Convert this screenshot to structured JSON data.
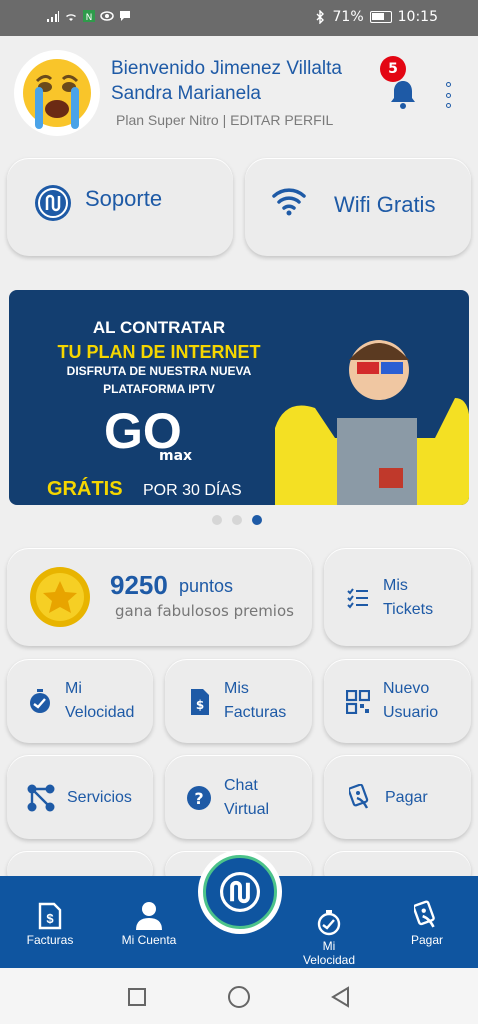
{
  "status": {
    "battery": "71%",
    "time": "10:15"
  },
  "header": {
    "welcome": "Bienvenido Jimenez Villalta Sandra Marianela",
    "plan": "Plan Super Nitro | EDITAR PERFIL",
    "notifications": "5"
  },
  "quick": {
    "support": "Soporte",
    "wifi": "Wifi Gratis"
  },
  "banner": {
    "line1": "AL CONTRATAR",
    "line2": "TU PLAN DE INTERNET",
    "line3": "DISFRUTA DE NUESTRA NUEVA",
    "line4": "PLATAFORMA IPTV",
    "brand": "GO",
    "brand_sub": "max",
    "free": "GRÁTIS",
    "free_rest": "POR 30 DÍAS"
  },
  "points": {
    "value": "9250",
    "unit": "puntos",
    "caption": "gana fabulosos premios"
  },
  "tiles": {
    "tickets": "Mis\nTickets",
    "velocidad": "Mi\nVelocidad",
    "facturas": "Mis\nFacturas",
    "nuevo_usuario": "Nuevo\nUsuario",
    "servicios": "Servicios",
    "chat": "Chat\nVirtual",
    "pagar": "Pagar"
  },
  "nav": {
    "facturas": "Facturas",
    "cuenta": "Mi Cuenta",
    "velocidad": "Mi\nVelocidad",
    "pagar": "Pagar"
  },
  "colors": {
    "brand_blue": "#0f55a0",
    "accent_yellow": "#f5d600",
    "badge_red": "#e30613"
  }
}
